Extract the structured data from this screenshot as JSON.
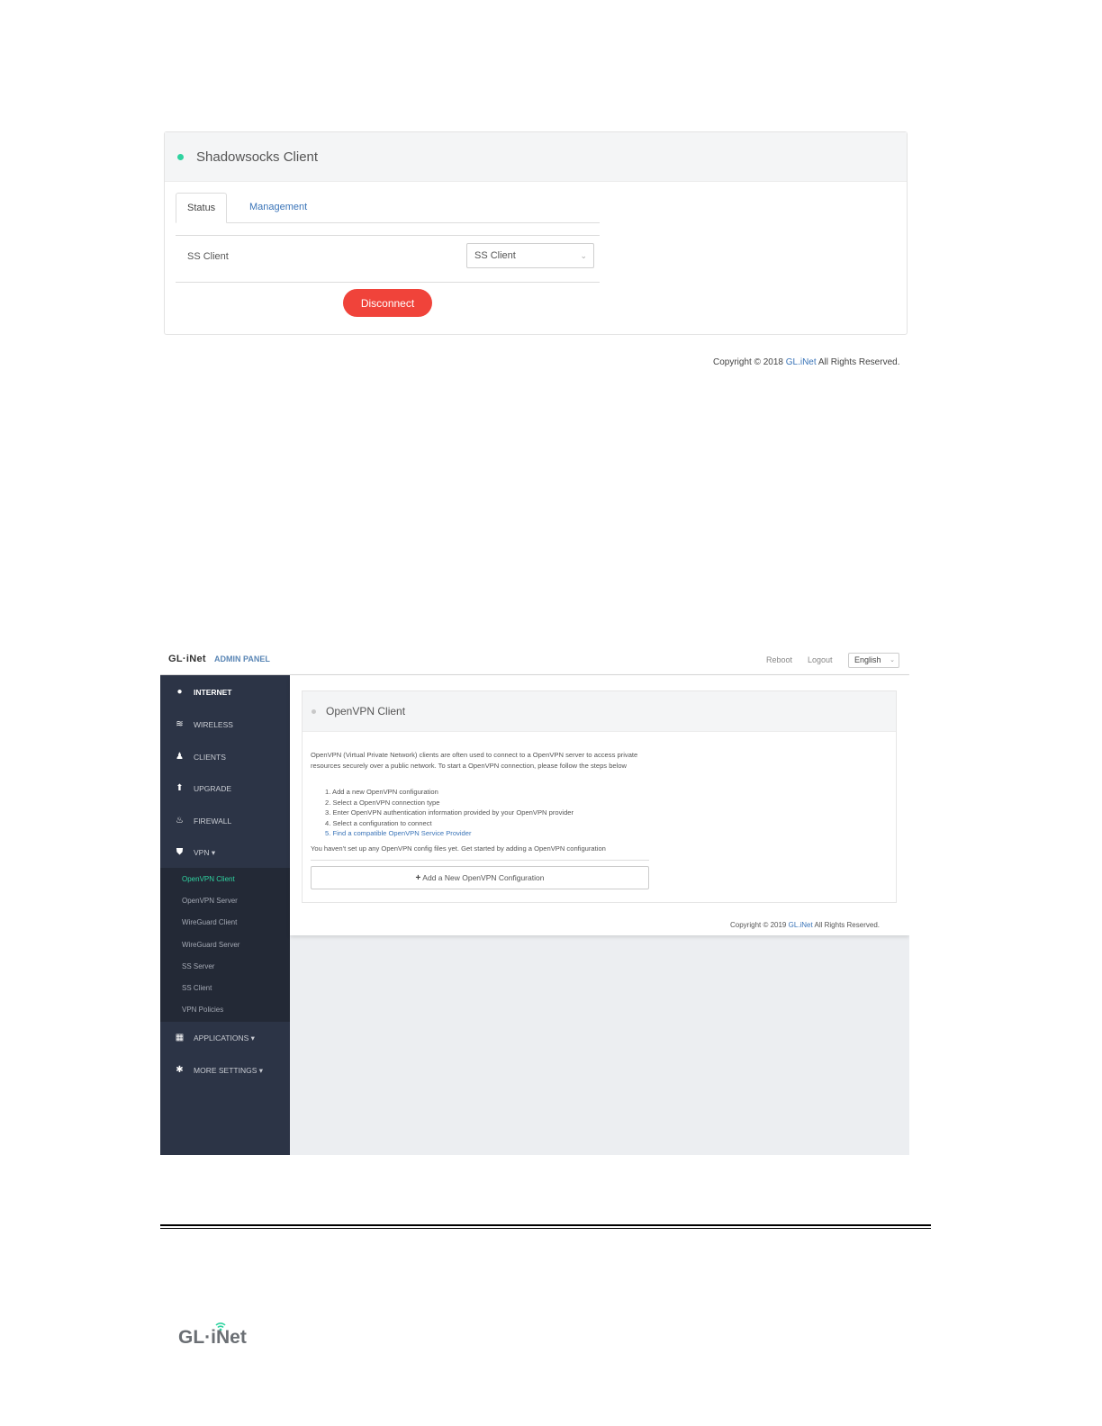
{
  "shadowsocks": {
    "title": "Shadowsocks Client",
    "tabs": [
      {
        "label": "Status",
        "active": true
      },
      {
        "label": "Management",
        "active": false
      }
    ],
    "field_label": "SS Client",
    "select_value": "SS Client",
    "disconnect_label": "Disconnect",
    "copyright_prefix": "Copyright © 2018 ",
    "copyright_link": "GL.iNet",
    "copyright_suffix": " All Rights Reserved."
  },
  "admin": {
    "brand": "GL·iNet",
    "brand_sub": "ADMIN PANEL",
    "top_links": [
      "Reboot",
      "Logout"
    ],
    "language": "English",
    "nav": [
      {
        "label": "INTERNET",
        "icon": "globe-icon"
      },
      {
        "label": "WIRELESS",
        "icon": "wifi-icon"
      },
      {
        "label": "CLIENTS",
        "icon": "user-icon"
      },
      {
        "label": "UPGRADE",
        "icon": "upgrade-icon"
      },
      {
        "label": "FIREWALL",
        "icon": "firewall-icon"
      },
      {
        "label": "VPN ▾",
        "icon": "shield-icon"
      },
      {
        "label": "APPLICATIONS ▾",
        "icon": "grid-icon"
      },
      {
        "label": "MORE SETTINGS ▾",
        "icon": "gear-icon"
      }
    ],
    "vpn_sub": [
      "OpenVPN Client",
      "OpenVPN Server",
      "WireGuard Client",
      "WireGuard Server",
      "SS Server",
      "SS Client",
      "VPN Policies"
    ],
    "panel_title": "OpenVPN Client",
    "intro": "OpenVPN (Virtual Private Network) clients are often used to connect to a OpenVPN server to access private resources securely over a public network. To start a OpenVPN connection, please follow the steps below",
    "steps": [
      "1. Add a new OpenVPN configuration",
      "2. Select a OpenVPN connection type",
      "3. Enter OpenVPN authentication information provided by your OpenVPN provider",
      "4. Select a configuration to connect",
      "5. Find a compatible OpenVPN Service Provider"
    ],
    "notice": "You haven't set up any OpenVPN config files yet. Get started by adding a OpenVPN configuration",
    "add_button": "Add a New OpenVPN Configuration",
    "copyright_prefix": "Copyright © 2019 ",
    "copyright_link": "GL.iNet",
    "copyright_suffix": " All Rights Reserved."
  },
  "footer": {
    "logo_text": "GL·iNet"
  },
  "colors": {
    "accent_green": "#2fd3a0",
    "disconnect_red": "#f0433a",
    "link_blue": "#3a74b8",
    "sidebar_dark": "#2c3446"
  }
}
